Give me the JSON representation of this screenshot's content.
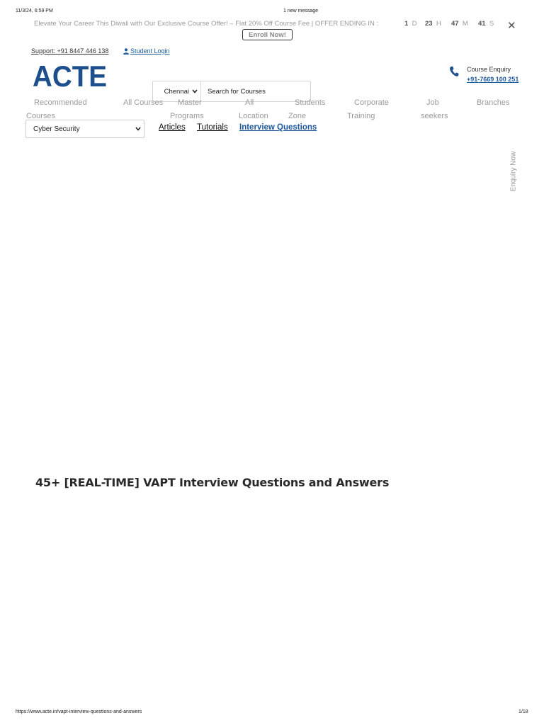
{
  "print_header": {
    "datetime": "11/3/24, 6:59 PM",
    "message": "1 new message"
  },
  "promo": {
    "text": "Elevate Your Career This Diwali with Our Exclusive Course Offer! – Flat 20% Off Course Fee | OFFER ENDING IN :",
    "countdown": [
      {
        "value": "1",
        "unit": "D"
      },
      {
        "value": "23",
        "unit": "H"
      },
      {
        "value": "47",
        "unit": "M"
      },
      {
        "value": "41",
        "unit": "S"
      }
    ],
    "button_label": "Enroll Now!",
    "close_symbol": "✕"
  },
  "topbar": {
    "support": "Support: +91 8447 446 138",
    "student_login": "Student Login"
  },
  "brand": {
    "logo_text": "ACTE",
    "logo_color": "#1c4f8c"
  },
  "search": {
    "city": "Chennai",
    "placeholder": "Search for Courses"
  },
  "enquiry": {
    "label": "Course Enquiry",
    "phone": "+91-7669 100 251"
  },
  "nav": {
    "items": [
      {
        "line1": "Recommended",
        "line2": "Courses"
      },
      {
        "line1": "All Courses",
        "line2": ""
      },
      {
        "line1": "Master",
        "line2": "Programs"
      },
      {
        "line1": "All",
        "line2": "Location"
      },
      {
        "line1": "Students",
        "line2": "Zone"
      },
      {
        "line1": "Corporate",
        "line2": "Training"
      },
      {
        "line1": "Job",
        "line2": "seekers"
      },
      {
        "line1": "Branches",
        "line2": ""
      }
    ]
  },
  "topic_filter": {
    "selected": "Cyber Security"
  },
  "tabs": [
    {
      "label": "Articles"
    },
    {
      "label": "Tutorials"
    },
    {
      "label": "Interview Questions"
    }
  ],
  "side_tab": {
    "label": "Enquiry Now"
  },
  "main": {
    "title": "45+ [REAL-TIME] VAPT Interview Questions and Answers"
  },
  "print_footer": {
    "url": "https://www.acte.in/vapt-interview-questions-and-answers",
    "page": "1/18"
  },
  "colors": {
    "brand_blue": "#1c4f8c",
    "link_blue": "#1c5aa0",
    "muted_gray": "#9a9a9a"
  },
  "icons": [
    "close-icon",
    "user-icon",
    "phone-icon",
    "chevron-down-icon"
  ]
}
